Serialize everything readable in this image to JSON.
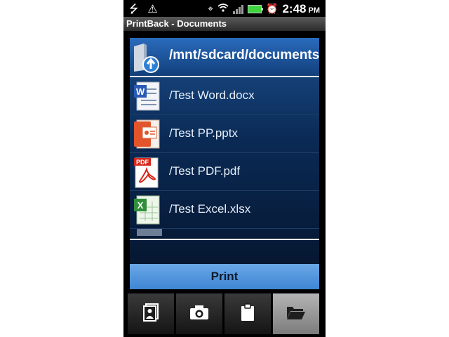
{
  "status_bar": {
    "time": "2:48",
    "time_suffix": "PM",
    "icons": [
      "usb-icon",
      "warning-icon",
      "gps-icon",
      "wifi-icon",
      "signal-icon",
      "battery-icon",
      "alarm-icon"
    ]
  },
  "title_bar": {
    "title": "PrintBack - Documents"
  },
  "browser": {
    "current_path": "/mnt/sdcard/documents",
    "files": [
      {
        "name": "/Test Word.docx",
        "icon": "word-icon"
      },
      {
        "name": "/Test PP.pptx",
        "icon": "powerpoint-icon"
      },
      {
        "name": "/Test PDF.pdf",
        "icon": "pdf-icon",
        "badge": "PDF"
      },
      {
        "name": "/Test Excel.xlsx",
        "icon": "excel-icon"
      }
    ]
  },
  "print_button": {
    "label": "Print"
  },
  "tabs": [
    {
      "icon": "photos-icon",
      "active": false
    },
    {
      "icon": "camera-icon",
      "active": false
    },
    {
      "icon": "clipboard-icon",
      "active": false
    },
    {
      "icon": "folder-open-icon",
      "active": true
    }
  ],
  "colors": {
    "accent": "#4a90dd",
    "panel_top": "#1c4e8c",
    "panel_bottom": "#061731",
    "battery": "#3fd33f"
  }
}
